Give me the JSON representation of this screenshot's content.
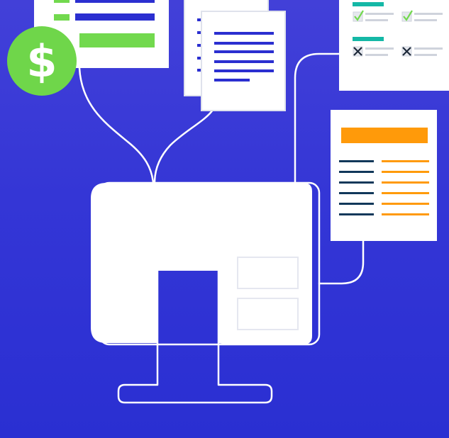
{
  "illustration": {
    "colors": {
      "background_top": "#4240d8",
      "background_bottom": "#2a2fd2",
      "white": "#ffffff",
      "green": "#72d94e",
      "blue_line": "#2b2fd0",
      "orange": "#ff9a0a",
      "teal": "#14b8a6",
      "navy": "#11385a",
      "gray": "#cfd3dc"
    },
    "coin": {
      "symbol": "$",
      "icon": "dollar-coin-icon"
    },
    "icons": [
      "document-icon",
      "checklist-icon",
      "checkmark-icon",
      "x-mark-icon",
      "monitor-icon"
    ]
  }
}
